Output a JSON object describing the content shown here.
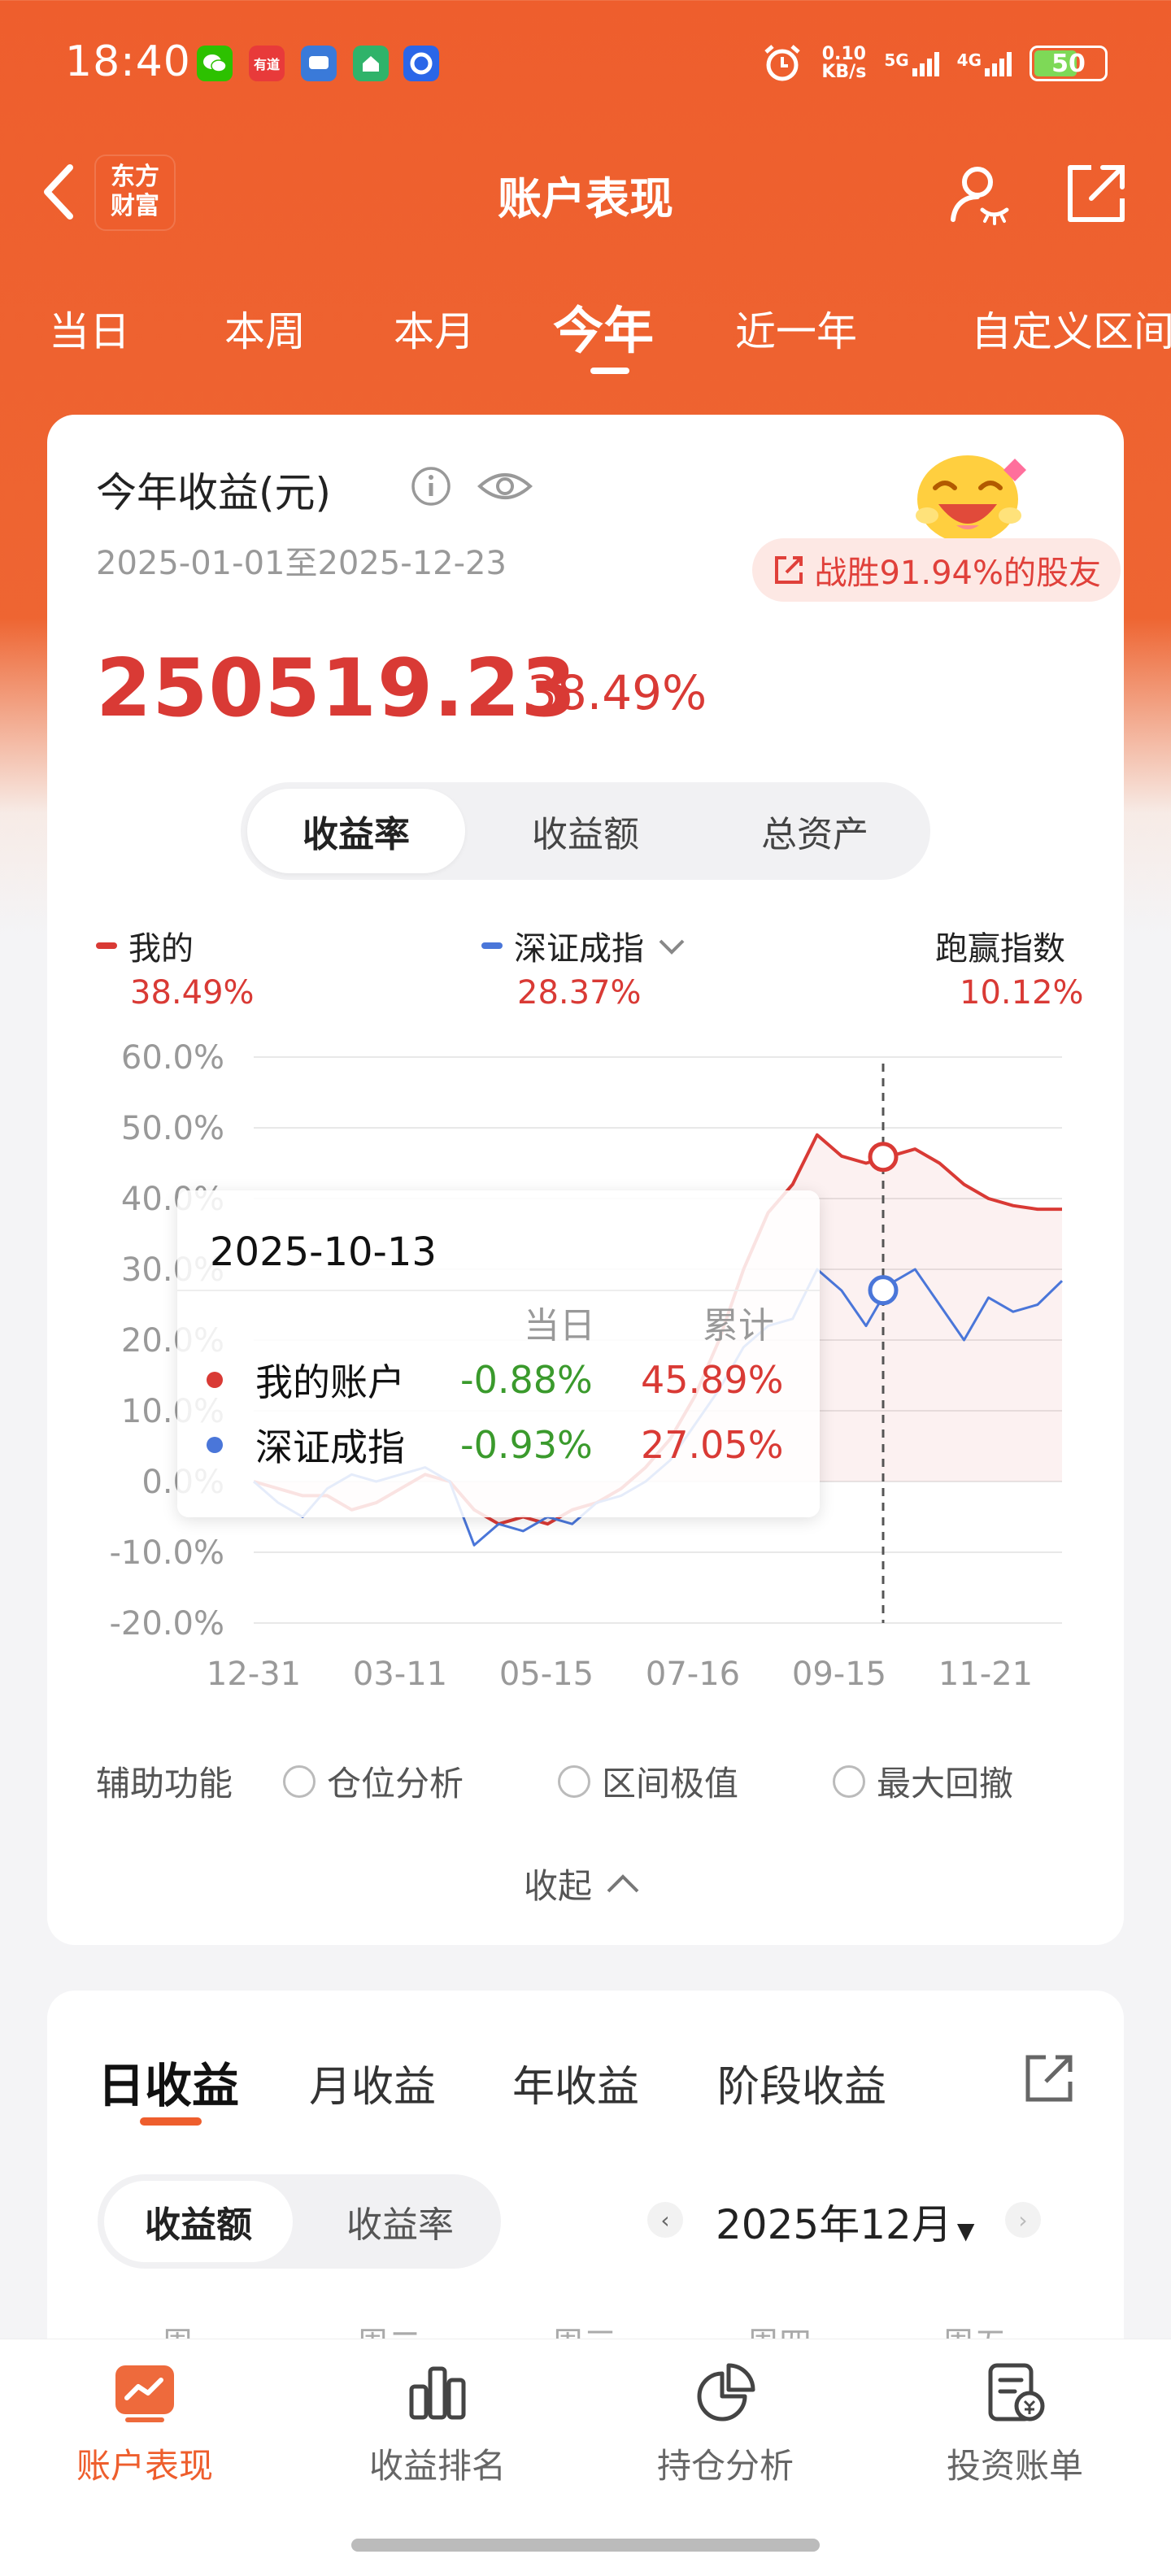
{
  "status_bar": {
    "time": "18:40",
    "net_speed": "0.10",
    "net_unit": "KB/s",
    "sig1": "5G",
    "sig2": "4G",
    "battery": "50",
    "app_icons": [
      "wechat",
      "有道",
      "message",
      "Anjuke",
      "browser"
    ]
  },
  "header": {
    "brand": "东方财富",
    "title": "账户表现",
    "back_icon": "back-icon",
    "profile_icon": "user-hide-icon",
    "share_icon": "share-icon"
  },
  "tabs": [
    "当日",
    "本周",
    "本月",
    "今年",
    "近一年",
    "自定义区间"
  ],
  "active_tab": "今年",
  "summary": {
    "label": "今年收益(元)",
    "date_range": "2025-01-01至2025-12-23",
    "beat": "战胜91.94%的股友",
    "value": "250519.23",
    "pct": "38.49%"
  },
  "seg_tabs": [
    "收益率",
    "收益额",
    "总资产"
  ],
  "legend": {
    "mine_name": "我的",
    "mine_val": "38.49%",
    "index_name": "深证成指",
    "index_val": "28.37%",
    "beat_name": "跑赢指数",
    "beat_val": "10.12%"
  },
  "colors": {
    "brand": "#ee5e2d",
    "mine": "#d93a35",
    "index": "#4a76d9",
    "green": "#3a9a2c"
  },
  "chart_data": {
    "type": "line",
    "x_ticks": [
      "12-31",
      "03-11",
      "05-15",
      "07-16",
      "09-15",
      "11-21"
    ],
    "y_ticks": [
      "60.0%",
      "50.0%",
      "40.0%",
      "30.0%",
      "20.0%",
      "10.0%",
      "0.0%",
      "-10.0%",
      "-20.0%"
    ],
    "ylim": [
      -20,
      60
    ],
    "series": [
      {
        "name": "我的",
        "values": [
          0,
          -1,
          -2,
          -2,
          -4,
          -3,
          -1,
          1,
          0,
          -4,
          -6,
          -5,
          -6,
          -4,
          -3,
          -1,
          2,
          6,
          12,
          20,
          30,
          38,
          42,
          49,
          46,
          45,
          46,
          47,
          45,
          42,
          40,
          39,
          38.49,
          38.49
        ]
      },
      {
        "name": "深证成指",
        "values": [
          0,
          -3,
          -5,
          -1,
          1,
          0,
          1,
          2,
          0,
          -9,
          -6,
          -7,
          -5,
          -6,
          -3,
          -2,
          0,
          3,
          8,
          13,
          19,
          22,
          23,
          30,
          27,
          22,
          28,
          30,
          25,
          20,
          26,
          24,
          25,
          28.37
        ]
      }
    ],
    "tooltip": {
      "date": "2025-10-13",
      "col_day": "当日",
      "col_cum": "累计",
      "rows": [
        {
          "name": "我的账户",
          "day": "-0.88%",
          "cum": "45.89%"
        },
        {
          "name": "深证成指",
          "day": "-0.93%",
          "cum": "27.05%"
        }
      ]
    }
  },
  "aux": {
    "label": "辅助功能",
    "options": [
      "仓位分析",
      "区间极值",
      "最大回撤"
    ],
    "collapse": "收起"
  },
  "returns": {
    "tabs": [
      "日收益",
      "月收益",
      "年收益",
      "阶段收益"
    ],
    "seg": [
      "收益额",
      "收益率"
    ],
    "month": "2025年12月",
    "weekdays": [
      "周一",
      "周二",
      "周三",
      "周四",
      "周五"
    ]
  },
  "bottom_nav": [
    "账户表现",
    "收益排名",
    "持仓分析",
    "投资账单"
  ]
}
